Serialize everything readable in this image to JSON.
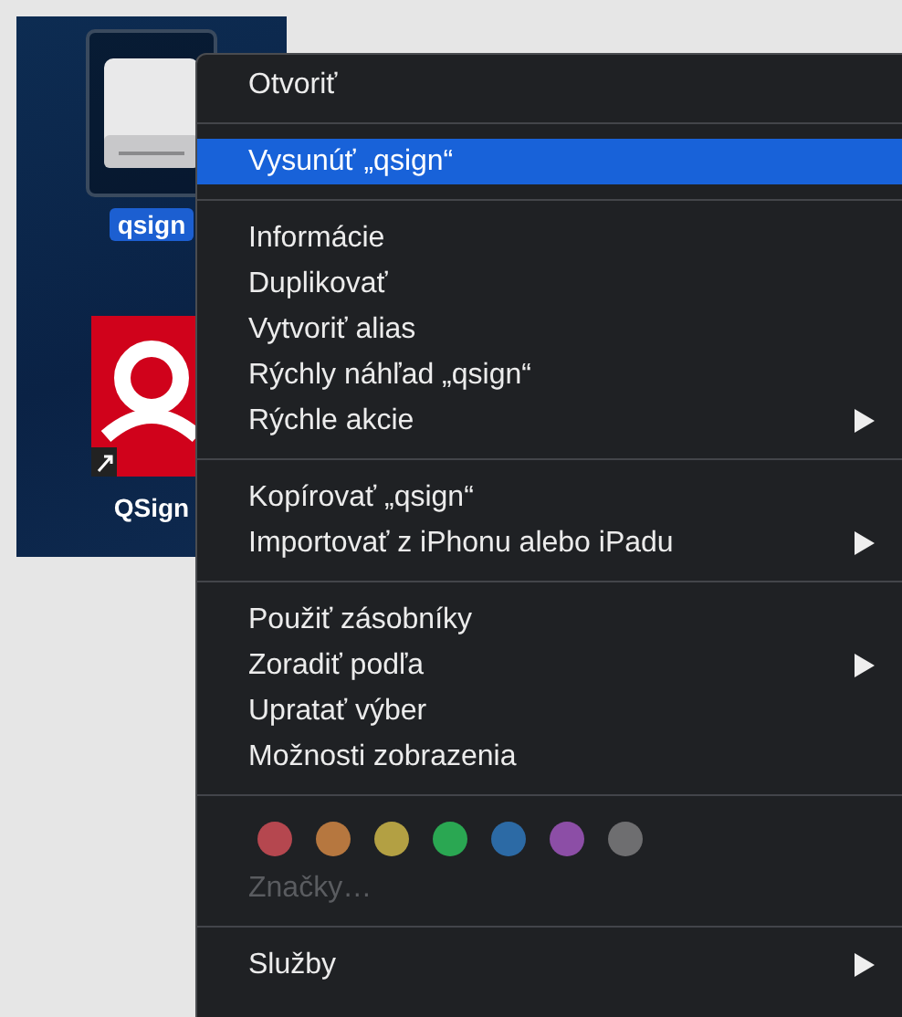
{
  "desktop": {
    "icons": [
      {
        "kind": "drive",
        "label": "qsign",
        "selected": true
      },
      {
        "kind": "app",
        "label": "QSign",
        "selected": false
      }
    ]
  },
  "context_menu": {
    "sections": [
      [
        {
          "kind": "item",
          "label": "Otvoriť",
          "selected": false,
          "disabled": false,
          "submenu": false
        }
      ],
      [
        {
          "kind": "item",
          "label": "Vysunúť „qsign“",
          "selected": true,
          "disabled": false,
          "submenu": false
        }
      ],
      [
        {
          "kind": "item",
          "label": "Informácie",
          "selected": false,
          "disabled": false,
          "submenu": false
        },
        {
          "kind": "item",
          "label": "Duplikovať",
          "selected": false,
          "disabled": false,
          "submenu": false
        },
        {
          "kind": "item",
          "label": "Vytvoriť alias",
          "selected": false,
          "disabled": false,
          "submenu": false
        },
        {
          "kind": "item",
          "label": "Rýchly náhľad „qsign“",
          "selected": false,
          "disabled": false,
          "submenu": false
        },
        {
          "kind": "item",
          "label": "Rýchle akcie",
          "selected": false,
          "disabled": false,
          "submenu": true
        }
      ],
      [
        {
          "kind": "item",
          "label": "Kopírovať „qsign“",
          "selected": false,
          "disabled": false,
          "submenu": false
        },
        {
          "kind": "item",
          "label": "Importovať z iPhonu alebo iPadu",
          "selected": false,
          "disabled": false,
          "submenu": true
        }
      ],
      [
        {
          "kind": "item",
          "label": "Použiť zásobníky",
          "selected": false,
          "disabled": false,
          "submenu": false
        },
        {
          "kind": "item",
          "label": "Zoradiť podľa",
          "selected": false,
          "disabled": false,
          "submenu": true
        },
        {
          "kind": "item",
          "label": "Upratať výber",
          "selected": false,
          "disabled": false,
          "submenu": false
        },
        {
          "kind": "item",
          "label": "Možnosti zobrazenia",
          "selected": false,
          "disabled": false,
          "submenu": false
        }
      ],
      [
        {
          "kind": "tags",
          "tags": [
            {
              "color": "#b5474f"
            },
            {
              "color": "#b6773f"
            },
            {
              "color": "#b3a043"
            },
            {
              "color": "#2aa752"
            },
            {
              "color": "#2c6aa5"
            },
            {
              "color": "#8c4ea6"
            },
            {
              "color": "#6e6e70"
            }
          ]
        },
        {
          "kind": "item",
          "label": "Značky…",
          "selected": false,
          "disabled": true,
          "submenu": false
        }
      ],
      [
        {
          "kind": "item",
          "label": "Služby",
          "selected": false,
          "disabled": false,
          "submenu": true
        }
      ]
    ]
  }
}
